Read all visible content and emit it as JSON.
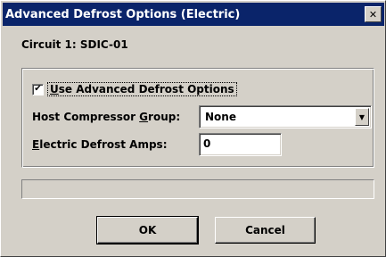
{
  "window": {
    "title": "Advanced Defrost Options (Electric)",
    "close_glyph": "✕"
  },
  "circuit_label": "Circuit 1: SDIC-01",
  "options": {
    "use_advanced": {
      "checked": true,
      "check_glyph": "✔",
      "label_accel": "U",
      "label_rest": "se Advanced Defrost Options"
    },
    "host_compressor_group": {
      "label_pre": "Host Compressor ",
      "label_accel": "G",
      "label_post": "roup:",
      "value": "None",
      "arrow_glyph": "▼"
    },
    "electric_defrost_amps": {
      "label_accel": "E",
      "label_rest": "lectric Defrost Amps:",
      "value": "0"
    }
  },
  "status_text": "",
  "buttons": {
    "ok": "OK",
    "cancel": "Cancel"
  }
}
